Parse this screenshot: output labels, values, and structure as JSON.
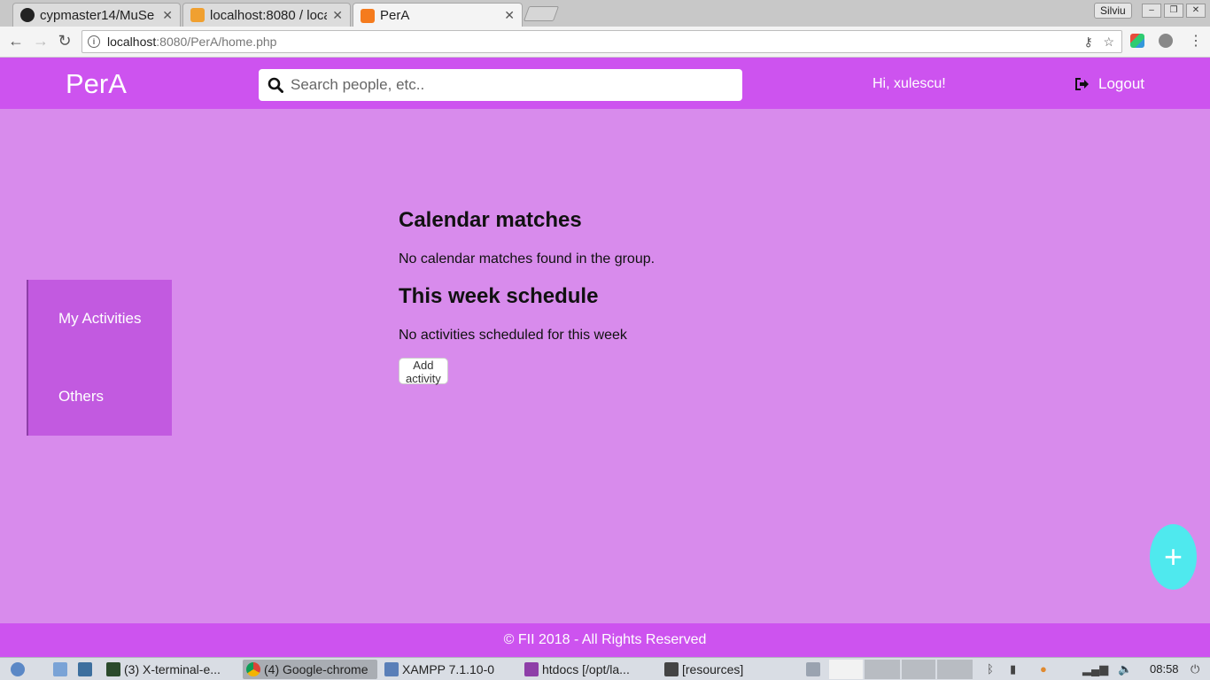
{
  "browser": {
    "tabs": [
      {
        "title": "cypmaster14/MuSe",
        "icon": "github-icon"
      },
      {
        "title": "localhost:8080 / loca",
        "icon": "phpmyadmin-icon"
      },
      {
        "title": "PerA",
        "icon": "xampp-icon",
        "active": true
      }
    ],
    "profile": "Silviu",
    "url_host": "localhost",
    "url_rest": ":8080/PerA/home.php"
  },
  "app": {
    "logo": "PerA",
    "search_placeholder": "Search people, etc..",
    "greeting": "Hi, xulescu!",
    "logout": "Logout",
    "accent_color": "#cd53ef",
    "background_color": "#d88bec",
    "fab_color": "#4fe9ee"
  },
  "sidebar": {
    "items": [
      {
        "label": "My Activities"
      },
      {
        "label": "Others"
      }
    ]
  },
  "main": {
    "calendar_heading": "Calendar matches",
    "calendar_text": "No calendar matches found in the group.",
    "schedule_heading": "This week schedule",
    "schedule_text": "No activities scheduled for this week",
    "add_button": "Add activity",
    "fab_symbol": "+"
  },
  "footer": {
    "text": "FII 2018 - All Rights Reserved"
  },
  "taskbar": {
    "tasks": [
      {
        "label": "(3) X-terminal-e...",
        "icon": "terminal-icon"
      },
      {
        "label": "(4) Google-chrome",
        "icon": "chrome-icon",
        "active": true
      },
      {
        "label": "XAMPP 7.1.10-0",
        "icon": "window-icon"
      },
      {
        "label": "htdocs [/opt/la...",
        "icon": "phpstorm-icon"
      },
      {
        "label": "[resources]",
        "icon": "folder-icon"
      }
    ],
    "clock": "08:58"
  }
}
